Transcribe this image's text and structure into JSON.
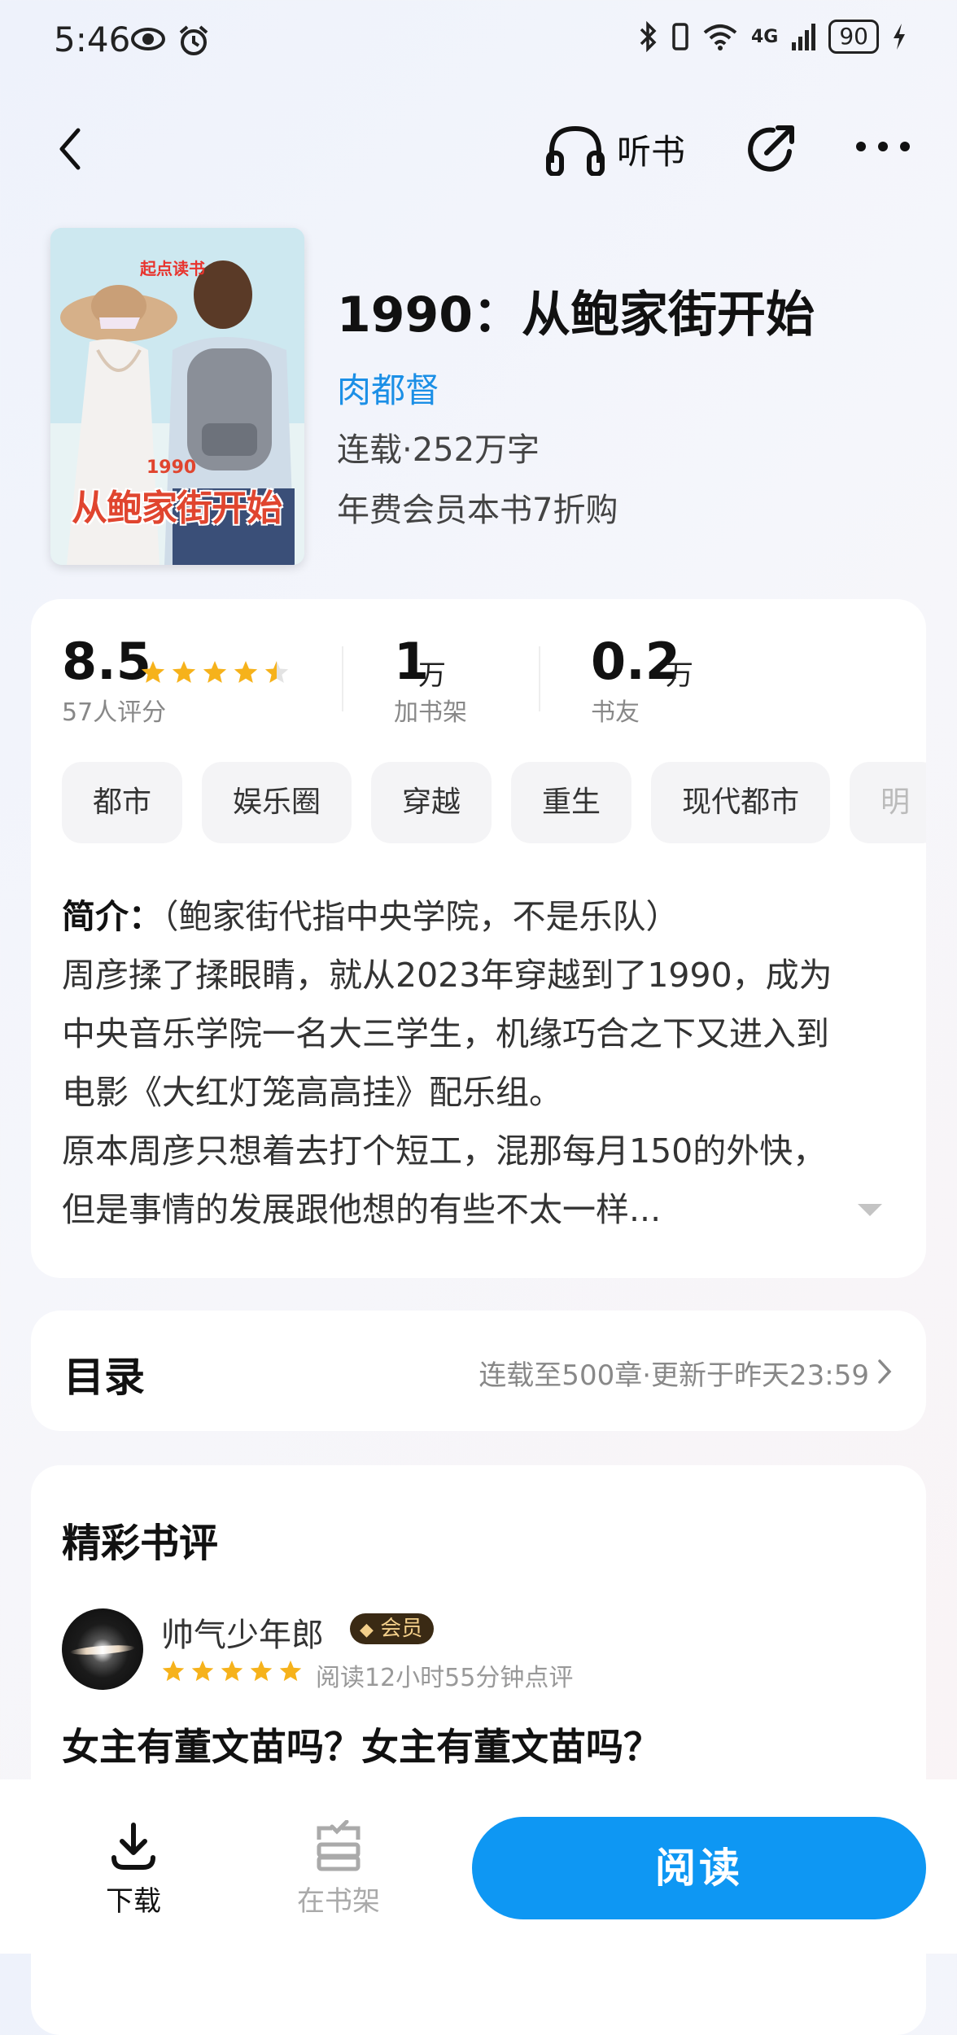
{
  "status_bar": {
    "time": "5:46",
    "network": "4G",
    "battery": "90"
  },
  "nav": {
    "listen_label": "听书"
  },
  "book": {
    "cover_brand": "起点读书",
    "cover_year": "1990",
    "cover_title": "从鲍家街开始",
    "title": "1990：从鲍家街开始",
    "author": "肉都督",
    "meta": "连载·252万字",
    "vip_offer": "年费会员本书7折购"
  },
  "stats": {
    "score": "8.5",
    "rating_stars": 4.5,
    "rating_count": "57人评分",
    "shelf_num": "1",
    "shelf_unit": "万",
    "shelf_label": "加书架",
    "fans_num": "0.2",
    "fans_unit": "万",
    "fans_label": "书友"
  },
  "tags": [
    "都市",
    "娱乐圈",
    "穿越",
    "重生",
    "现代都市",
    "明"
  ],
  "intro": {
    "label": "简介：",
    "lines": [
      "（鲍家街代指中央学院，不是乐队）",
      "周彦揉了揉眼睛，就从2023年穿越到了1990，成为",
      "中央音乐学院一名大三学生，机缘巧合之下又进入到",
      "电影《大红灯笼高高挂》配乐组。",
      "原本周彦只想着去打个短工，混那每月150的外快，",
      "但是事情的发展跟他想的有些不太一样..."
    ]
  },
  "toc": {
    "title": "目录",
    "status": "连载至500章·更新于昨天23:59"
  },
  "reviews": {
    "title": "精彩书评",
    "items": [
      {
        "user": "帅气少年郎",
        "badge": "会员",
        "stars": 5,
        "meta": "阅读12小时55分钟点评",
        "title": "女主有董文苗吗？女主有董文苗吗？"
      }
    ]
  },
  "bottom": {
    "download_label": "下载",
    "shelf_label": "在书架",
    "read_label": "阅读"
  },
  "colors": {
    "accent": "#0e97f3",
    "author": "#1b8fe6",
    "star": "#f6b21b"
  }
}
